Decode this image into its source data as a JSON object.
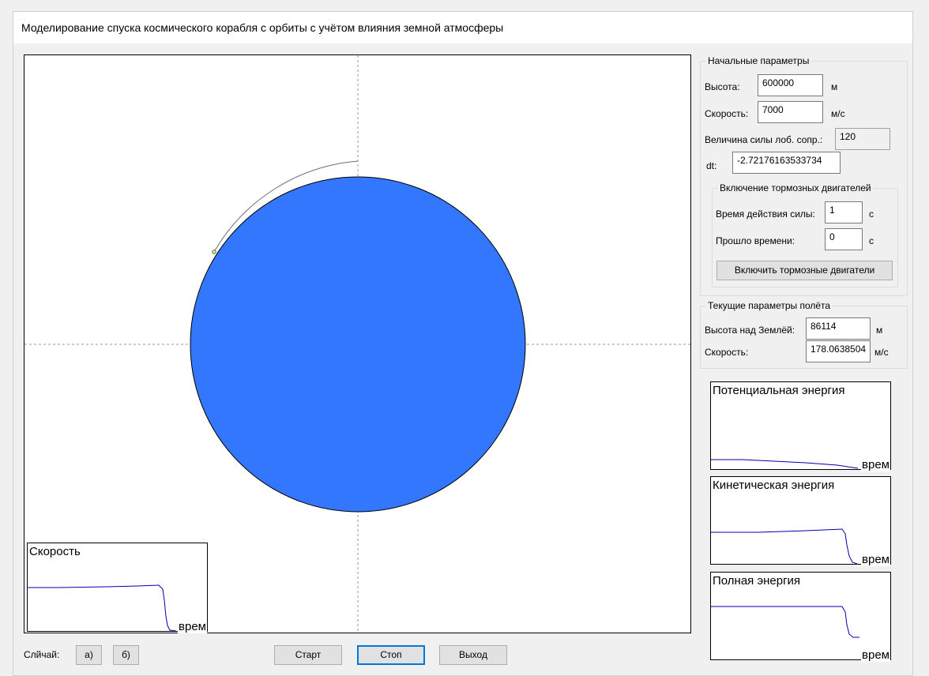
{
  "window": {
    "title": "Моделирование спуска космического корабля с орбиты с учётом влияния земной атмосферы"
  },
  "colors": {
    "earth": "#3377ff",
    "graph_line": "#0000aa",
    "trajectory": "#6e6e6e"
  },
  "initial_params": {
    "legend": "Начальные параметры",
    "height_label": "Высота:",
    "height_value": "600000",
    "height_unit": "м",
    "speed_label": "Скорость:",
    "speed_value": "7000",
    "speed_unit": "м/с",
    "drag_label": "Величина силы лоб. сопр.:",
    "drag_value": "120",
    "dt_label": "dt:",
    "dt_value": "-2.72176163533734"
  },
  "brake": {
    "legend": "Включение тормозных двигателей",
    "time_label": "Время действия силы:",
    "time_value": "1",
    "time_unit": "с",
    "elapsed_label": "Прошло времени:",
    "elapsed_value": "0",
    "elapsed_unit": "с",
    "button": "Включить тормозные двигатели"
  },
  "current_params": {
    "legend": "Текущие параметры полёта",
    "height_label": "Высота над Землёй:",
    "height_value": "86114",
    "height_unit": "м",
    "speed_label": "Скорость:",
    "speed_value": "178.0638504",
    "speed_unit": "м/с"
  },
  "charts": {
    "speed": {
      "title": "Скорость",
      "axis": "врем"
    },
    "potential": {
      "title": "Потенциальная энергия",
      "axis": "врем"
    },
    "kinetic": {
      "title": "Кинетическая энергия",
      "axis": "врем"
    },
    "total": {
      "title": "Полная энергия",
      "axis": "врем"
    }
  },
  "bottom": {
    "case_label": "Слйчай:",
    "case_a": "а)",
    "case_b": "б)",
    "start": "Старт",
    "stop": "Стоп",
    "exit": "Выход"
  }
}
